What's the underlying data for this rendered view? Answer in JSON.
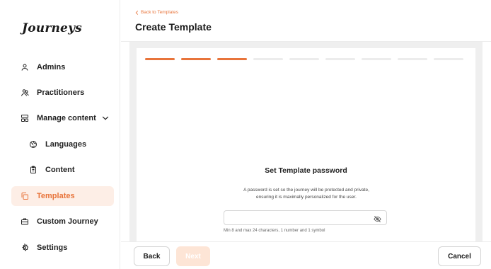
{
  "app": {
    "logo": "Journeys"
  },
  "sidebar": {
    "items": [
      {
        "label": "Admins",
        "icon": "user-icon"
      },
      {
        "label": "Practitioners",
        "icon": "users-icon"
      },
      {
        "label": "Manage content",
        "icon": "layout-icon",
        "expanded": true
      },
      {
        "label": "Languages",
        "icon": "globe-icon"
      },
      {
        "label": "Content",
        "icon": "clipboard-icon"
      },
      {
        "label": "Templates",
        "icon": "copy-icon",
        "active": true
      },
      {
        "label": "Custom Journey",
        "icon": "briefcase-icon"
      },
      {
        "label": "Settings",
        "icon": "gear-icon"
      }
    ]
  },
  "header": {
    "back_label": "Back to Templates",
    "title": "Create Template"
  },
  "wizard": {
    "steps_total": 9,
    "steps_completed": 3,
    "title": "Set Template password",
    "description_line1": "A password is set so the journey will be protected and private,",
    "description_line2": "ensuring it is maximally personalized for the user.",
    "password_value": "",
    "hint": "Min 8 and max 24 characters, 1 number and 1 symbol"
  },
  "footer": {
    "back_label": "Back",
    "next_label": "Next",
    "cancel_label": "Cancel"
  },
  "colors": {
    "accent": "#e8743b",
    "active_bg": "#fdeee6",
    "next_disabled_bg": "#fde5d6"
  }
}
